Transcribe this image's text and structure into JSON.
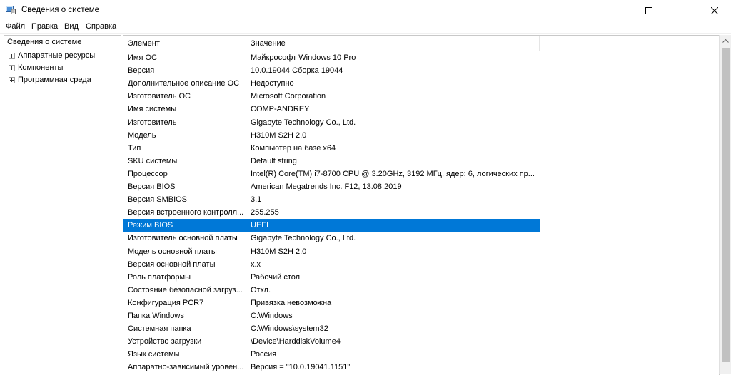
{
  "window": {
    "title": "Сведения о системе",
    "controls": {
      "minimize": "minimize",
      "maximize": "maximize",
      "close": "close"
    }
  },
  "menu": [
    "Файл",
    "Правка",
    "Вид",
    "Справка"
  ],
  "tree": {
    "root": "Сведения о системе",
    "children": [
      "Аппаратные ресурсы",
      "Компоненты",
      "Программная среда"
    ]
  },
  "list": {
    "headers": [
      "Элемент",
      "Значение"
    ],
    "selected_index": 14,
    "selection_color": "#0078d7",
    "rows": [
      [
        "Имя ОС",
        "Майкрософт Windows 10 Pro"
      ],
      [
        "Версия",
        "10.0.19044 Сборка 19044"
      ],
      [
        "Дополнительное описание ОС",
        "Недоступно"
      ],
      [
        "Изготовитель ОС",
        "Microsoft Corporation"
      ],
      [
        "Имя системы",
        "COMP-ANDREY"
      ],
      [
        "Изготовитель",
        "Gigabyte Technology Co., Ltd."
      ],
      [
        "Модель",
        "H310M S2H 2.0"
      ],
      [
        "Тип",
        "Компьютер на базе x64"
      ],
      [
        "SKU системы",
        "Default string"
      ],
      [
        "Процессор",
        "Intel(R) Core(TM) i7-8700 CPU @ 3.20GHz, 3192 МГц, ядер: 6, логических пр..."
      ],
      [
        "Версия BIOS",
        "American Megatrends Inc. F12, 13.08.2019"
      ],
      [
        "Версия SMBIOS",
        "3.1"
      ],
      [
        "Версия встроенного контролл...",
        "255.255"
      ],
      [
        "Режим BIOS",
        "UEFI"
      ],
      [
        "Изготовитель основной платы",
        "Gigabyte Technology Co., Ltd."
      ],
      [
        "Модель основной платы",
        "H310M S2H 2.0"
      ],
      [
        "Версия основной платы",
        "x.x"
      ],
      [
        "Роль платформы",
        "Рабочий стол"
      ],
      [
        "Состояние безопасной загруз...",
        "Откл."
      ],
      [
        "Конфигурация PCR7",
        "Привязка невозможна"
      ],
      [
        "Папка Windows",
        "C:\\Windows"
      ],
      [
        "Системная папка",
        "C:\\Windows\\system32"
      ],
      [
        "Устройство загрузки",
        "\\Device\\HarddiskVolume4"
      ],
      [
        "Язык системы",
        "Россия"
      ],
      [
        "Аппаратно-зависимый уровен...",
        "Версия = \"10.0.19041.1151\""
      ]
    ]
  }
}
